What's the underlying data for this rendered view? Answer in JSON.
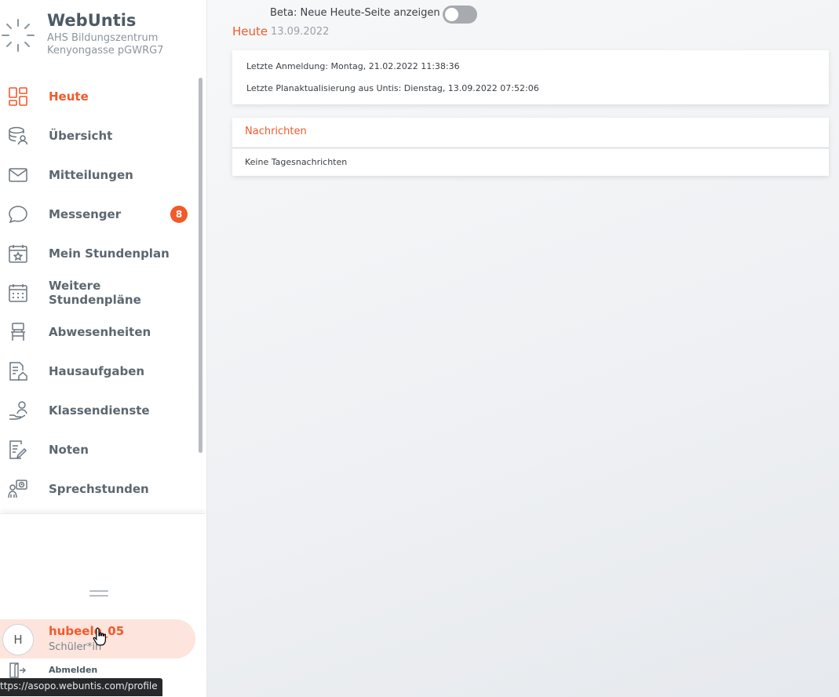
{
  "brand": {
    "name": "WebUntis",
    "school_line1": "AHS Bildungszentrum",
    "school_line2": "Kenyongasse pGWRG7"
  },
  "nav": {
    "items": [
      {
        "label": "Heute",
        "icon": "dashboard-icon",
        "active": true
      },
      {
        "label": "Übersicht",
        "icon": "overview-icon"
      },
      {
        "label": "Mitteilungen",
        "icon": "mail-icon"
      },
      {
        "label": "Messenger",
        "icon": "chat-bubble-icon",
        "badge": "8"
      },
      {
        "label": "Mein Stundenplan",
        "icon": "calendar-star-icon"
      },
      {
        "label": "Weitere Stundenpläne",
        "icon": "calendar-grid-icon"
      },
      {
        "label": "Abwesenheiten",
        "icon": "chair-icon"
      },
      {
        "label": "Hausaufgaben",
        "icon": "homework-icon"
      },
      {
        "label": "Klassendienste",
        "icon": "class-duty-icon"
      },
      {
        "label": "Noten",
        "icon": "grades-icon"
      },
      {
        "label": "Sprechstunden",
        "icon": "office-hours-icon"
      }
    ]
  },
  "profile": {
    "initial": "H",
    "name": "hubeele_05",
    "role": "Schüler*in"
  },
  "logout": {
    "label": "Abmelden"
  },
  "status_bar": {
    "url": "ttps://asopo.webuntis.com/profile"
  },
  "main": {
    "beta_label": "Beta: Neue Heute-Seite anzeigen",
    "beta_enabled": false,
    "title": "Heute",
    "date": "13.09.2022",
    "info": {
      "last_login": "Letzte Anmeldung: Montag, 21.02.2022 11:38:36",
      "last_update": "Letzte Planaktualisierung aus Untis: Dienstag, 13.09.2022 07:52:06"
    },
    "news": {
      "title": "Nachrichten",
      "empty": "Keine Tagesnachrichten"
    }
  },
  "colors": {
    "accent": "#f15a2b",
    "sidebar_text": "#5c6770",
    "badge": "#f15a2b"
  }
}
